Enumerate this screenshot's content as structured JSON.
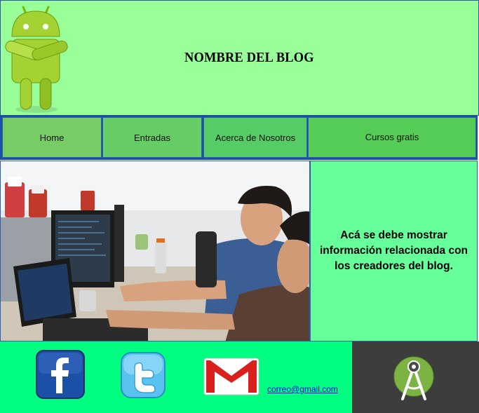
{
  "header": {
    "title": "NOMBRE DEL BLOG",
    "logo_icon": "android-robot-icon",
    "background": "#99ff99"
  },
  "nav": {
    "items": [
      {
        "label": "Home",
        "color": "#77cc66"
      },
      {
        "label": "Entradas",
        "color": "#66cc66"
      },
      {
        "label": "Acerca de Nosotros",
        "color": "#55cc66"
      },
      {
        "label": "Cursos gratis",
        "color": "#55cc55"
      }
    ]
  },
  "hero": {
    "image": "photo-of-developers-at-computers"
  },
  "sidebar": {
    "text": "Acá se debe mostrar información relacionada con los creadores del blog."
  },
  "footer": {
    "icons": [
      "facebook-icon",
      "twitter-icon",
      "gmail-icon"
    ],
    "email": "correo@gmail.com",
    "right_icon": "android-studio-icon"
  }
}
